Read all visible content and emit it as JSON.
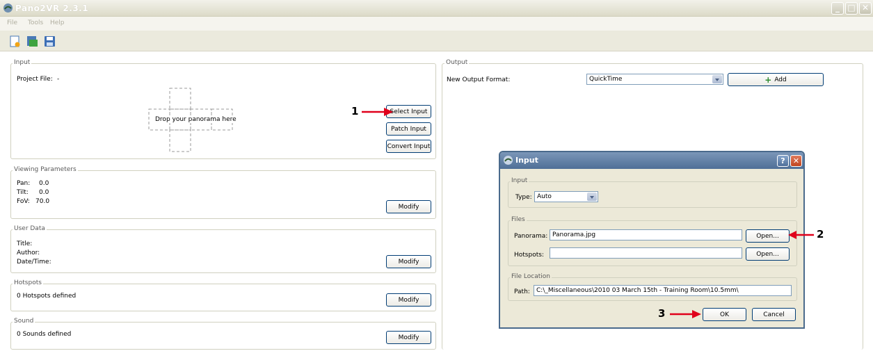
{
  "window": {
    "title": "Pano2VR 2.3.1"
  },
  "menu": [
    "File",
    "Tools",
    "Help"
  ],
  "input_group": {
    "title": "Input",
    "project_label": "Project File:",
    "project_value": "-",
    "drop_text": "Drop your panorama here",
    "select_button": "Select Input",
    "patch_button": "Patch Input",
    "convert_button": "Convert Input"
  },
  "viewing_group": {
    "title": "Viewing Parameters",
    "pan_label": "Pan:",
    "pan_value": "0.0",
    "tilt_label": "Tilt:",
    "tilt_value": "0.0",
    "fov_label": "FoV:",
    "fov_value": "70.0",
    "modify_button": "Modify"
  },
  "user_data_group": {
    "title": "User Data",
    "title_label": "Title:",
    "author_label": "Author:",
    "datetime_label": "Date/Time:",
    "modify_button": "Modify"
  },
  "hotspots_group": {
    "title": "Hotspots",
    "status": "0 Hotspots defined",
    "modify_button": "Modify"
  },
  "sound_group": {
    "title": "Sound",
    "status": "0 Sounds defined",
    "modify_button": "Modify"
  },
  "output_group": {
    "title": "Output",
    "format_label": "New Output Format:",
    "format_value": "QuickTime",
    "add_button": "Add"
  },
  "dialog": {
    "title": "Input",
    "input_section": "Input",
    "type_label": "Type:",
    "type_value": "Auto",
    "files_section": "Files",
    "panorama_label": "Panorama:",
    "panorama_value": "Panorama.jpg",
    "hotspots_label": "Hotspots:",
    "hotspots_value": "",
    "open_button": "Open...",
    "location_section": "File Location",
    "path_label": "Path:",
    "path_value": "C:\\_Miscellaneous\\2010 03 March 15th - Training Room\\10.5mm\\",
    "ok_button": "OK",
    "cancel_button": "Cancel"
  },
  "annotations": [
    "1",
    "2",
    "3"
  ],
  "colors": {
    "arrow": "#e0001b",
    "button_border": "#003c74",
    "dialog_title": "#4f6f97"
  }
}
